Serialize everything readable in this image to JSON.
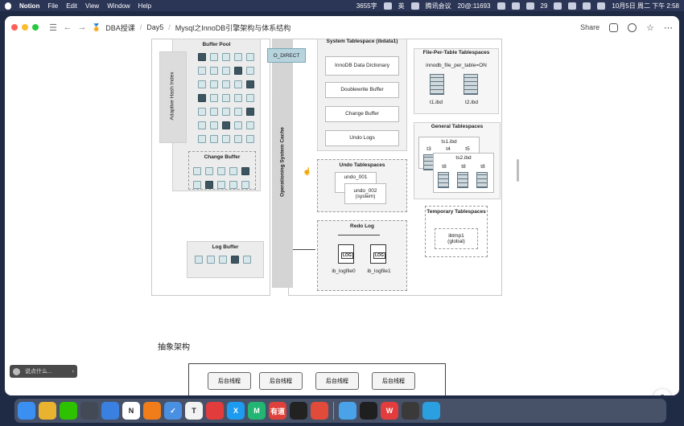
{
  "menubar": {
    "app_name": "Notion",
    "menus": [
      "File",
      "Edit",
      "View",
      "Window",
      "Help"
    ],
    "word_count": "3655字",
    "input_method": "英",
    "meeting": "腾讯会议",
    "meeting_id": "20@:11693",
    "wechat_count": "29",
    "datetime": "10月5日 周二 下午 2:58"
  },
  "titlebar": {
    "breadcrumbs": [
      "DBA授课",
      "Day5",
      "Mysql之InnoDB引擎架构与体系结构"
    ],
    "share_label": "Share"
  },
  "diagram": {
    "buffer_pool": "Buffer Pool",
    "adaptive_hash_index": "Adaptive Hash Index",
    "change_buffer": "Change Buffer",
    "log_buffer": "Log Buffer",
    "os_cache": "Operationing System Cache",
    "o_direct": "O_DIRECT",
    "system_tablespace": "System Tablespace (ibdata1)",
    "innodb_data_dictionary": "InnoDB Data Dictionary",
    "doublewrite_buffer": "Doublewrite Buffer",
    "change_buffer_sys": "Change Buffer",
    "undo_logs": "Undo Logs",
    "undo_tablespaces": "Undo Tablespaces",
    "undo_001": "undo_001",
    "undo_002": "undo_002",
    "undo_002_sub": "(system)",
    "redo_log": "Redo Log",
    "ib_logfile0": "ib_logfile0",
    "ib_logfile1": "ib_logfile1",
    "log_label": "LOG",
    "file_per_table": "File-Per-Table Tablespaces",
    "file_per_table_setting": "innodb_file_per_table=ON",
    "t1_ibd": "t1.ibd",
    "t2_ibd": "t2.ibd",
    "general_tablespaces": "General Tablespaces",
    "ts1_ibd": "ts1.ibd",
    "ts2_ibd": "ts2.ibd",
    "t3": "t3",
    "t4": "t4",
    "t5": "t5",
    "t8": "t8",
    "temporary_tablespaces": "Temporary Tablespaces",
    "ibtmp1": "ibtmp1",
    "ibtmp1_sub": "(global)"
  },
  "abstract": {
    "title": "抽象架构",
    "thread_label": "后台线程"
  },
  "chat": {
    "placeholder": "说点什么..."
  },
  "help": {
    "label": "?"
  },
  "dock": {
    "apps": [
      {
        "name": "finder",
        "color": "#3b8ff0",
        "glyph": ""
      },
      {
        "name": "chrome",
        "color": "#e9b330",
        "glyph": ""
      },
      {
        "name": "wechat",
        "color": "#2dc100",
        "glyph": ""
      },
      {
        "name": "terminal-preview",
        "color": "#444a55",
        "glyph": ""
      },
      {
        "name": "app-blue",
        "color": "#3a80e0",
        "glyph": ""
      },
      {
        "name": "notion",
        "color": "#ffffff",
        "glyph": "N"
      },
      {
        "name": "sublime",
        "color": "#f07d1a",
        "glyph": ""
      },
      {
        "name": "things",
        "color": "#4a90e2",
        "glyph": "✓"
      },
      {
        "name": "typora",
        "color": "#f2f2f2",
        "glyph": "T"
      },
      {
        "name": "netease-music",
        "color": "#e33c3c",
        "glyph": ""
      },
      {
        "name": "xmind",
        "color": "#1d9bf0",
        "glyph": "X"
      },
      {
        "name": "intellij",
        "color": "#22b573",
        "glyph": "M"
      },
      {
        "name": "youdao",
        "color": "#e0403a",
        "glyph": "有道"
      },
      {
        "name": "qq",
        "color": "#222",
        "glyph": ""
      },
      {
        "name": "tencent-meeting",
        "color": "#e24a3a",
        "glyph": ""
      },
      {
        "name": "dingtalk",
        "color": "#4aa3e8",
        "glyph": ""
      },
      {
        "name": "activity-monitor",
        "color": "#1f1f1f",
        "glyph": ""
      },
      {
        "name": "wps",
        "color": "#e33c3c",
        "glyph": "W"
      },
      {
        "name": "screen-record",
        "color": "#3a3a3a",
        "glyph": ""
      },
      {
        "name": "app-teal",
        "color": "#2aa0e0",
        "glyph": ""
      }
    ]
  }
}
